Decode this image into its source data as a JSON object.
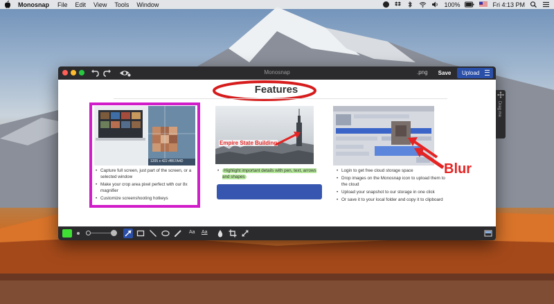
{
  "menubar": {
    "app_name": "Monosnap",
    "items": [
      "File",
      "Edit",
      "View",
      "Tools",
      "Window"
    ],
    "battery": "100%",
    "clock": "Fri 4:13 PM"
  },
  "window": {
    "title": "Monosnap",
    "extension": ".png",
    "save_label": "Save",
    "upload_label": "Upload",
    "drag_label": "Drag me"
  },
  "canvas": {
    "heading": "Features",
    "col1_caption": "1205 x 422 #B57A4D",
    "col1_items": [
      "Capture full screen, just part of the screen, or a selected window",
      "Make your crop area pixel perfect with our 8x magnifier",
      "Customize screenshooting hotkeys"
    ],
    "col2_annotation": "Empire State Building",
    "col2_items": [
      "Highlight important details with pen, text, arrows and shapes"
    ],
    "col3_items": [
      "Login to get free cloud storage space",
      "Drop images on the Monosnap icon to upload them to the cloud",
      "Upload your snapshot to our storage in one click",
      "Or save it to your local folder and copy it to clipboard"
    ]
  },
  "overlay": {
    "blur_label": "Blur"
  },
  "toolbar": {
    "text_tool": "Aa",
    "text_bg_tool": "Aa"
  },
  "colors": {
    "accent": "#2a4fa8",
    "highlight_frame": "#d11cc9",
    "annotation_red": "#e52322",
    "pen_color": "#3fe034"
  }
}
